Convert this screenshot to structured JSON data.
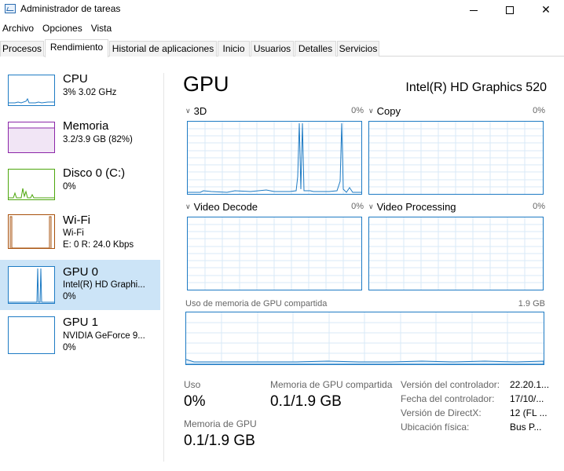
{
  "window": {
    "title": "Administrador de tareas"
  },
  "menu": [
    "Archivo",
    "Opciones",
    "Vista"
  ],
  "tabs": [
    "Procesos",
    "Rendimiento",
    "Historial de aplicaciones",
    "Inicio",
    "Usuarios",
    "Detalles",
    "Servicios"
  ],
  "active_tab": "Rendimiento",
  "sidebar": {
    "items": [
      {
        "name": "CPU",
        "line1": "3% 3.02 GHz",
        "line2": "",
        "color": "#1e7bc4"
      },
      {
        "name": "Memoria",
        "line1": "3.2/3.9 GB (82%)",
        "line2": "",
        "color": "#8b26a8"
      },
      {
        "name": "Disco 0 (C:)",
        "line1": "0%",
        "line2": "",
        "color": "#4da60c"
      },
      {
        "name": "Wi-Fi",
        "line1": "Wi-Fi",
        "line2": "E: 0 R: 24.0 Kbps",
        "color": "#a7500b"
      },
      {
        "name": "GPU 0",
        "line1": "Intel(R) HD Graphi...",
        "line2": "0%",
        "color": "#1e7bc4"
      },
      {
        "name": "GPU 1",
        "line1": "NVIDIA GeForce 9...",
        "line2": "0%",
        "color": "#1e7bc4"
      }
    ],
    "selected": "GPU 0"
  },
  "main": {
    "title": "GPU",
    "device": "Intel(R) HD Graphics 520",
    "engines": [
      {
        "label": "3D",
        "percent": "0%"
      },
      {
        "label": "Copy",
        "percent": "0%"
      },
      {
        "label": "Video Decode",
        "percent": "0%"
      },
      {
        "label": "Video Processing",
        "percent": "0%"
      }
    ],
    "shared_memory": {
      "label": "Uso de memoria de GPU compartida",
      "max": "1.9 GB"
    },
    "stats": {
      "usage_label": "Uso",
      "usage_value": "0%",
      "shared_label": "Memoria de GPU compartida",
      "shared_value": "0.1/1.9 GB",
      "gpu_mem_label": "Memoria de GPU",
      "gpu_mem_value": "0.1/1.9 GB"
    },
    "info": [
      {
        "label": "Versión del controlador:",
        "value": "22.20.1..."
      },
      {
        "label": "Fecha del controlador:",
        "value": "17/10/..."
      },
      {
        "label": "Versión de DirectX:",
        "value": "12 (FL ..."
      },
      {
        "label": "Ubicación física:",
        "value": "Bus P..."
      }
    ]
  },
  "colors": {
    "accent": "#1e7bc4",
    "selected_bg": "#cce4f7",
    "grid": "#d9eaf7"
  }
}
